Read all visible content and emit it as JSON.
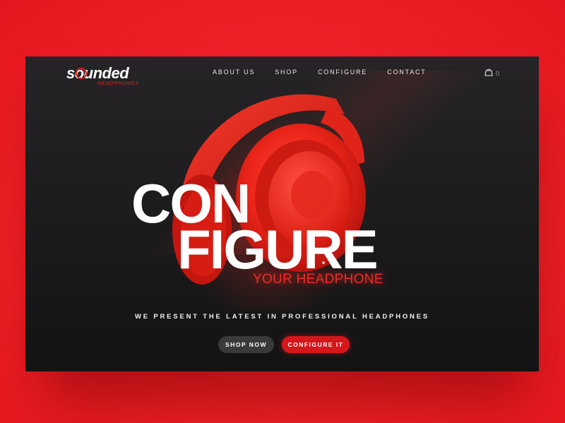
{
  "brand": {
    "name": "sounded",
    "subtitle": "HEADPHONES",
    "accent": "#e3231f"
  },
  "nav": {
    "items": [
      "ABOUT US",
      "SHOP",
      "CONFIGURE",
      "CONTACT"
    ]
  },
  "cart": {
    "icon": "shopping-bag-icon",
    "count": "0"
  },
  "hero": {
    "headline_line1": "CON",
    "headline_line2": "FIGURE",
    "subheadline": "YOUR HEADPHONE",
    "tagline": "WE PRESENT THE LATEST IN PROFESSIONAL HEADPHONES",
    "image": "red-headphones"
  },
  "buttons": {
    "shop_now": "SHOP NOW",
    "configure_it": "CONFIGURE IT"
  },
  "colors": {
    "background": "#f2242a",
    "panel": "#1e1d1e",
    "primary_button": "#d5161b",
    "secondary_button": "#3a393b"
  }
}
